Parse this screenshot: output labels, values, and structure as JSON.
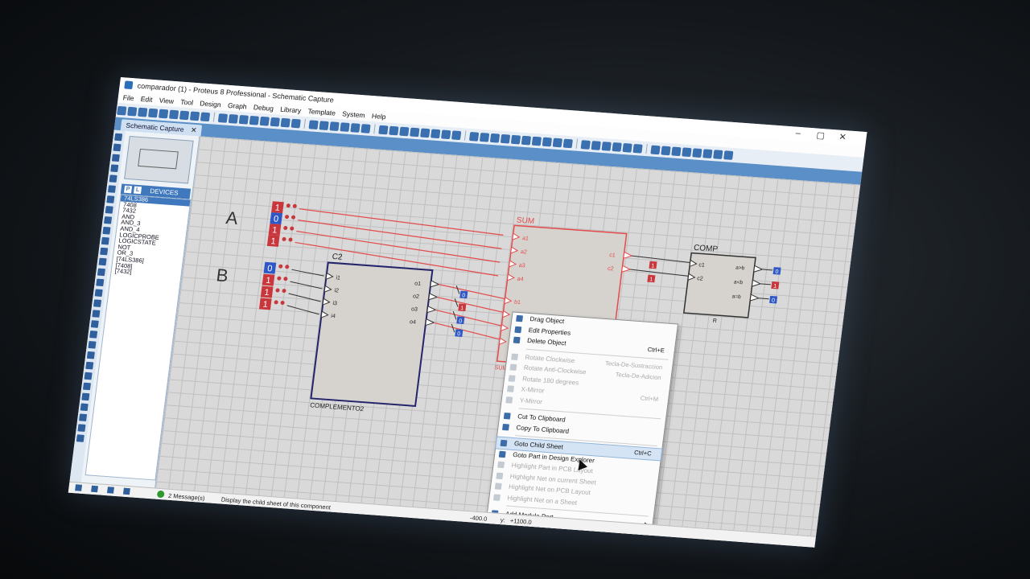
{
  "window": {
    "title": "comparador (1) - Proteus 8 Professional - Schematic Capture",
    "controls": [
      "–",
      "▢",
      "✕"
    ]
  },
  "menu": [
    "File",
    "Edit",
    "View",
    "Tool",
    "Design",
    "Graph",
    "Debug",
    "Library",
    "Template",
    "System",
    "Help"
  ],
  "tab": {
    "label": "Schematic Capture",
    "close": "✕"
  },
  "devices": {
    "p_label": "P",
    "l_label": "L",
    "header": "DEVICES",
    "items": [
      "74LS386",
      "7408",
      "7432",
      "AND",
      "AND_3",
      "AND_4",
      "LOGICPROBE",
      "LOGICSTATE",
      "NOT",
      "OR_3",
      "[74LS386]",
      "[7408]",
      "[7432]"
    ],
    "selected": "74LS386"
  },
  "schematic": {
    "label_a": "A",
    "label_b": "B",
    "inputs_a": [
      "1",
      "0",
      "1",
      "1"
    ],
    "inputs_b": [
      "0",
      "1",
      "1",
      "1"
    ],
    "c2": {
      "name": "C2",
      "footer": "COMPLEMENTO2",
      "in_pins": [
        "i1",
        "i2",
        "i3",
        "i4"
      ],
      "out_pins": [
        "o1",
        "o2",
        "o3",
        "o4"
      ],
      "probes": [
        "0",
        "1",
        "0",
        "0"
      ]
    },
    "sum": {
      "name": "SUM",
      "footer": "SUMADOR",
      "a_pins": [
        "a1",
        "a2",
        "a3",
        "a4"
      ],
      "b_pins": [
        "b1",
        "b2",
        "b3",
        "b4"
      ],
      "out_pins": [
        "c1",
        "c2"
      ],
      "probes": [
        "1",
        "1"
      ]
    },
    "comp": {
      "name": "COMP",
      "footer": "R",
      "in_pins": [
        "c1",
        "c2"
      ],
      "out_pins": [
        "a>b",
        "a<b",
        "a=b"
      ],
      "probes": [
        "0",
        "1",
        "0"
      ]
    }
  },
  "context_menu": {
    "items": [
      {
        "label": "Drag Object",
        "shortcut": "",
        "disabled": false
      },
      {
        "label": "Edit Properties",
        "shortcut": "",
        "disabled": false
      },
      {
        "label": "Delete Object",
        "shortcut": "Ctrl+E",
        "disabled": false
      },
      {
        "label": "Rotate Clockwise",
        "shortcut": "Tecla-De-Sustraccion",
        "disabled": true
      },
      {
        "label": "Rotate Anti-Clockwise",
        "shortcut": "Tecla-De-Adicion",
        "disabled": true
      },
      {
        "label": "Rotate 180 degrees",
        "shortcut": "",
        "disabled": true
      },
      {
        "label": "X-Mirror",
        "shortcut": "Ctrl+M",
        "disabled": true
      },
      {
        "label": "Y-Mirror",
        "shortcut": "",
        "disabled": true
      },
      {
        "label": "Cut To Clipboard",
        "shortcut": "",
        "disabled": false
      },
      {
        "label": "Copy To Clipboard",
        "shortcut": "",
        "disabled": false
      },
      {
        "label": "Goto Child Sheet",
        "shortcut": "Ctrl+C",
        "disabled": false,
        "highlighted": true
      },
      {
        "label": "Goto Part in Design Explorer",
        "shortcut": "",
        "disabled": false
      },
      {
        "label": "Highlight Part in PCB Layout",
        "shortcut": "",
        "disabled": true
      },
      {
        "label": "Highlight Net on current Sheet",
        "shortcut": "",
        "disabled": true
      },
      {
        "label": "Highlight Net on PCB Layout",
        "shortcut": "",
        "disabled": true
      },
      {
        "label": "Highlight Net on a Sheet",
        "shortcut": "",
        "disabled": true
      },
      {
        "label": "Add Module Port",
        "shortcut": "",
        "disabled": false,
        "submenu": true
      }
    ]
  },
  "status": {
    "messages": "2 Message(s)",
    "hint": "Display the child sheet of this component",
    "coord_x": "-400.0",
    "coord_y_label": "y:",
    "coord_y": "+1100.0"
  },
  "colors": {
    "wire_red": "#e34a4a",
    "c2_body": "#d6d3cf",
    "c2_border": "#24246a",
    "probe_blue": "#2f58c7",
    "probe_red": "#c9363b",
    "logic_on": "#c9363b",
    "logic_off": "#2f58c7"
  }
}
